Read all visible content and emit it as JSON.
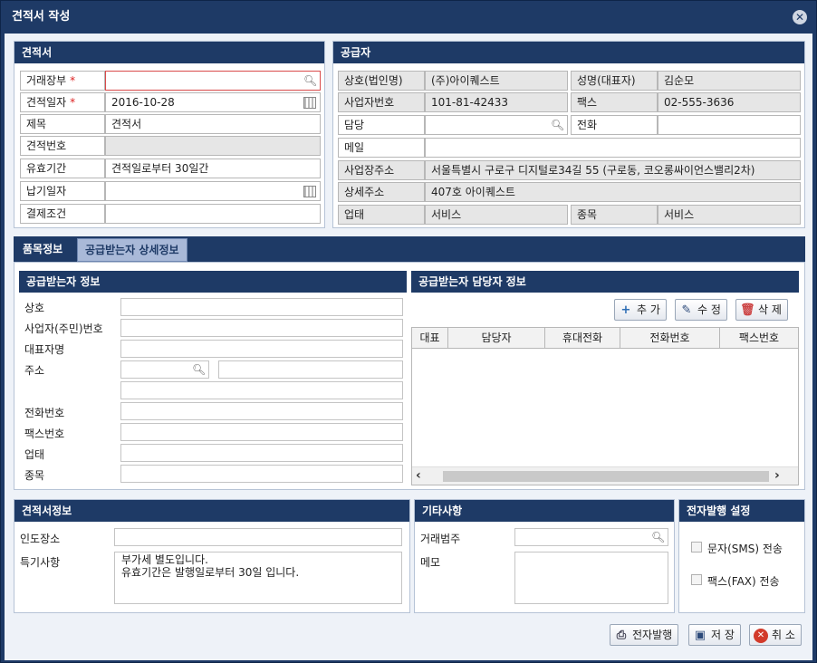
{
  "window": {
    "title": "견적서 작성"
  },
  "estimate": {
    "header": "견적서",
    "trade_ledger": {
      "label": "거래장부",
      "value": ""
    },
    "estimate_date": {
      "label": "견적일자",
      "value": "2016-10-28"
    },
    "subject": {
      "label": "제목",
      "value": "견적서"
    },
    "estimate_no": {
      "label": "견적번호",
      "value": ""
    },
    "validity": {
      "label": "유효기간",
      "value": "견적일로부터 30일간"
    },
    "delivery_date": {
      "label": "납기일자",
      "value": ""
    },
    "payment_terms": {
      "label": "결제조건",
      "value": ""
    },
    "required_mark": "*"
  },
  "supplier": {
    "header": "공급자",
    "company": {
      "label": "상호(법인명)",
      "value": "(주)아이퀘스트"
    },
    "ceo": {
      "label": "성명(대표자)",
      "value": "김순모"
    },
    "biz_no": {
      "label": "사업자번호",
      "value": "101-81-42433"
    },
    "fax": {
      "label": "팩스",
      "value": "02-555-3636"
    },
    "manager": {
      "label": "담당",
      "value": ""
    },
    "phone": {
      "label": "전화",
      "value": ""
    },
    "email": {
      "label": "메일",
      "value": ""
    },
    "address": {
      "label": "사업장주소",
      "value": "서울특별시 구로구 디지털로34길 55 (구로동, 코오롱싸이언스밸리2차)"
    },
    "address_detail": {
      "label": "상세주소",
      "value": "407호 아이퀘스트"
    },
    "business_type": {
      "label": "업태",
      "value": "서비스"
    },
    "business_item": {
      "label": "종목",
      "value": "서비스"
    }
  },
  "tabs": [
    {
      "label": "품목정보",
      "active": true
    },
    {
      "label": "공급받는자 상세정보",
      "active": false
    }
  ],
  "receiver": {
    "header": "공급받는자 정보",
    "fields": {
      "company": "상호",
      "biz_no": "사업자(주민)번호",
      "ceo": "대표자명",
      "address": "주소",
      "phone": "전화번호",
      "fax": "팩스번호",
      "business_type": "업태",
      "business_item": "종목"
    }
  },
  "contacts": {
    "header": "공급받는자 담당자 정보",
    "buttons": {
      "add": "추 가",
      "edit": "수 정",
      "delete": "삭 제"
    },
    "columns": [
      "대표",
      "담당자",
      "휴대전화",
      "전화번호",
      "팩스번호"
    ],
    "rows": []
  },
  "estimate_info": {
    "header": "견적서정보",
    "delivery_place": {
      "label": "인도장소",
      "value": ""
    },
    "notes": {
      "label": "특기사항",
      "line1": "부가세 별도입니다.",
      "line2": "유효기간은 발행일로부터 30일 입니다."
    }
  },
  "other": {
    "header": "기타사항",
    "category": {
      "label": "거래범주",
      "value": ""
    },
    "memo": {
      "label": "메모",
      "value": ""
    }
  },
  "e_issue": {
    "header": "전자발행 설정",
    "sms": {
      "label": "문자(SMS) 전송",
      "checked": false
    },
    "fax": {
      "label": "팩스(FAX) 전송",
      "checked": false
    }
  },
  "footer": {
    "issue": "전자발행",
    "save": "저 장",
    "cancel": "취 소"
  },
  "colors": {
    "navy": "#1e3a66",
    "required": "#d22222",
    "tab_inactive": "#a9b9d8"
  }
}
